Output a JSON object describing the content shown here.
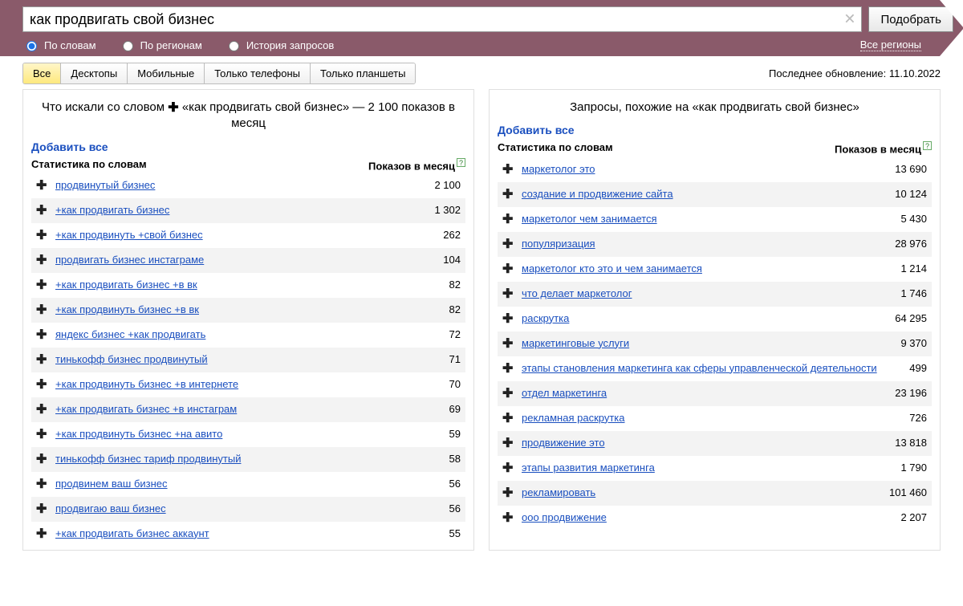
{
  "search": {
    "value": "как продвигать свой бизнес",
    "button": "Подобрать"
  },
  "modes": {
    "by_words": "По словам",
    "by_regions": "По регионам",
    "history": "История запросов"
  },
  "regions_link": "Все регионы",
  "device_tabs": {
    "all": "Все",
    "desktop": "Десктопы",
    "mobile": "Мобильные",
    "phones": "Только телефоны",
    "tablets": "Только планшеты"
  },
  "last_update_label": "Последнее обновление: 11.10.2022",
  "left_panel": {
    "title_prefix": "Что искали со словом ",
    "title_query": "«как продвигать свой бизнес»",
    "title_suffix": " — 2 100 показов в месяц",
    "add_all": "Добавить все",
    "col_left": "Статистика по словам",
    "col_right": "Показов в месяц",
    "rows": [
      {
        "kw": "продвинутый бизнес",
        "n": "2 100"
      },
      {
        "kw": "+как продвигать бизнес",
        "n": "1 302"
      },
      {
        "kw": "+как продвинуть +свой бизнес",
        "n": "262"
      },
      {
        "kw": "продвигать бизнес инстаграме",
        "n": "104"
      },
      {
        "kw": "+как продвигать бизнес +в вк",
        "n": "82"
      },
      {
        "kw": "+как продвинуть бизнес +в вк",
        "n": "82"
      },
      {
        "kw": "яндекс бизнес +как продвигать",
        "n": "72"
      },
      {
        "kw": "тинькофф бизнес продвинутый",
        "n": "71"
      },
      {
        "kw": "+как продвинуть бизнес +в интернете",
        "n": "70"
      },
      {
        "kw": "+как продвигать бизнес +в инстаграм",
        "n": "69"
      },
      {
        "kw": "+как продвинуть бизнес +на авито",
        "n": "59"
      },
      {
        "kw": "тинькофф бизнес тариф продвинутый",
        "n": "58"
      },
      {
        "kw": "продвинем ваш бизнес",
        "n": "56"
      },
      {
        "kw": "продвигаю ваш бизнес",
        "n": "56"
      },
      {
        "kw": "+как продвигать бизнес аккаунт",
        "n": "55"
      }
    ]
  },
  "right_panel": {
    "title": "Запросы, похожие на «как продвигать свой бизнес»",
    "add_all": "Добавить все",
    "col_left": "Статистика по словам",
    "col_right": "Показов в месяц",
    "rows": [
      {
        "kw": "маркетолог это",
        "n": "13 690"
      },
      {
        "kw": "создание и продвижение сайта",
        "n": "10 124"
      },
      {
        "kw": "маркетолог чем занимается",
        "n": "5 430"
      },
      {
        "kw": "популяризация",
        "n": "28 976"
      },
      {
        "kw": "маркетолог кто это и чем занимается",
        "n": "1 214"
      },
      {
        "kw": "что делает маркетолог",
        "n": "1 746"
      },
      {
        "kw": "раскрутка",
        "n": "64 295"
      },
      {
        "kw": "маркетинговые услуги",
        "n": "9 370"
      },
      {
        "kw": "этапы становления маркетинга как сферы управленческой деятельности",
        "n": "499"
      },
      {
        "kw": "отдел маркетинга",
        "n": "23 196"
      },
      {
        "kw": "рекламная раскрутка",
        "n": "726"
      },
      {
        "kw": "продвижение это",
        "n": "13 818"
      },
      {
        "kw": "этапы развития маркетинга",
        "n": "1 790"
      },
      {
        "kw": "рекламировать",
        "n": "101 460"
      },
      {
        "kw": "ооо продвижение",
        "n": "2 207"
      }
    ]
  }
}
